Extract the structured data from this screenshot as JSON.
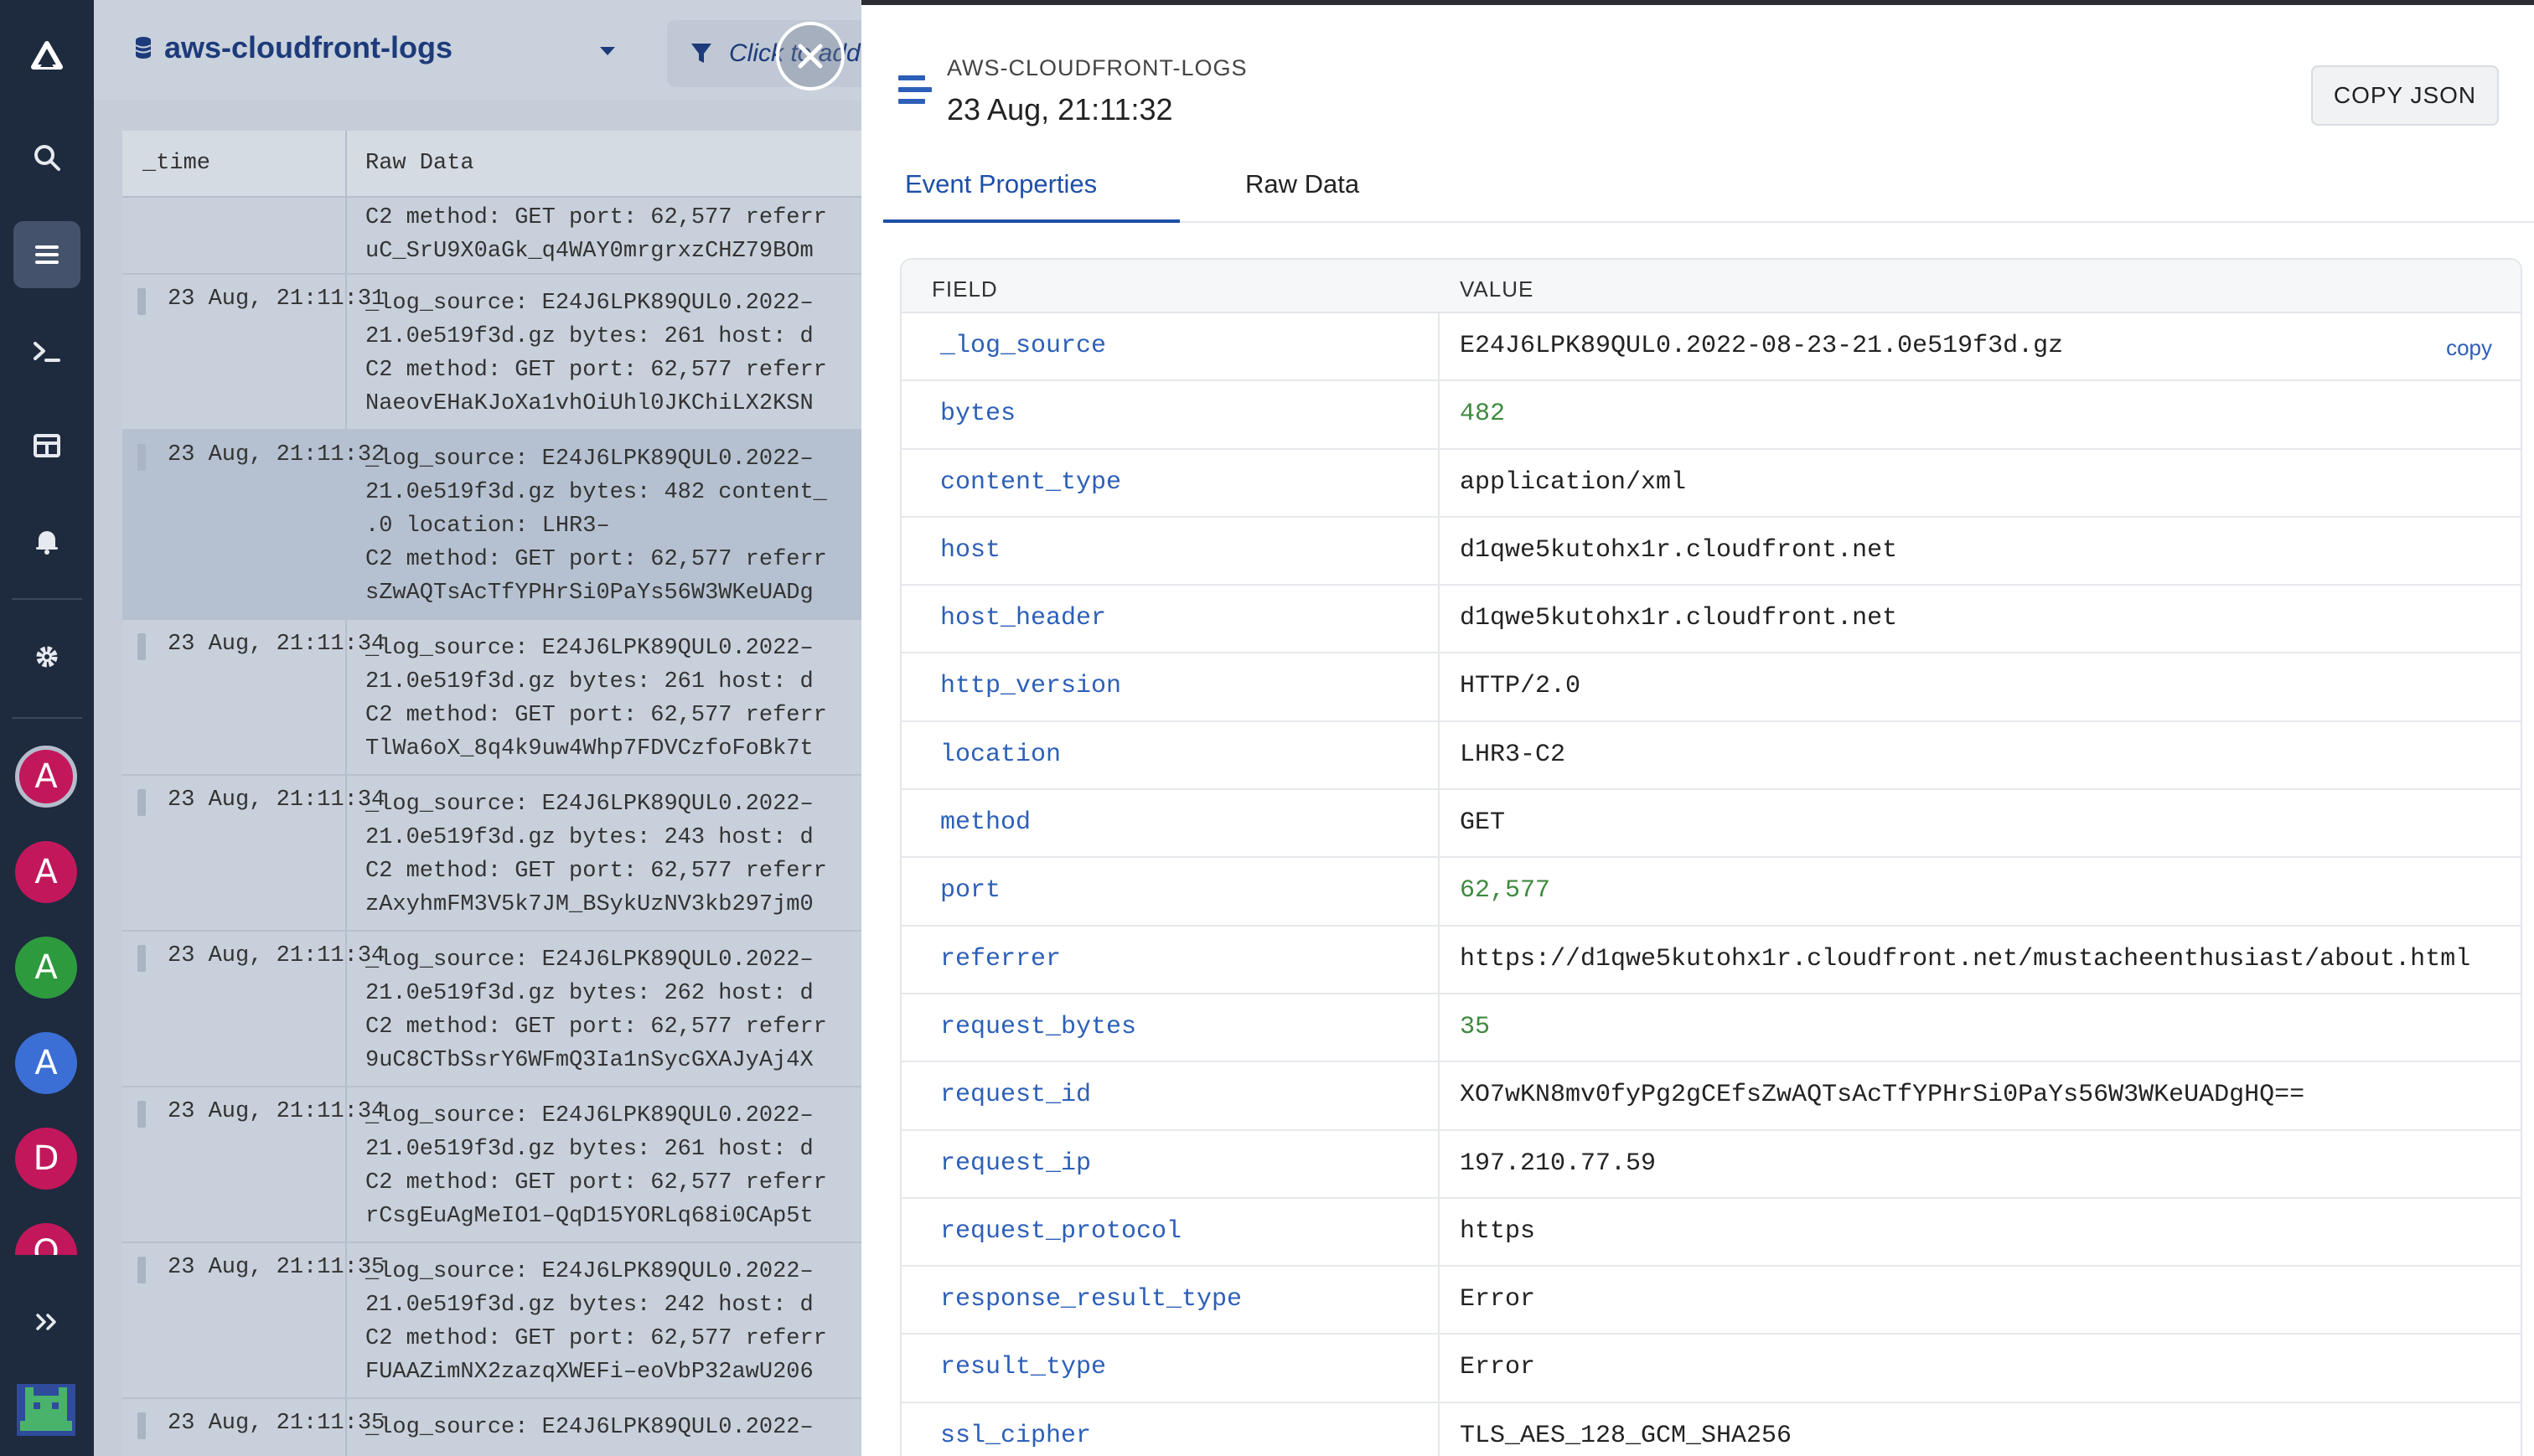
{
  "datasource": {
    "name": "aws-cloudfront-logs",
    "filter_placeholder": "Click to add"
  },
  "table": {
    "col_time": "_time",
    "col_raw": "Raw Data",
    "rows": [
      {
        "time": "",
        "lines": [
          "C2 method: GET port: 62,577 referr",
          "uC_SrU9X0aGk_q4WAY0mrgrxzCHZ79BOm"
        ]
      },
      {
        "time": "23 Aug, 21:11:31",
        "lines": [
          "_log_source: E24J6LPK89QUL0.2022–",
          "21.0e519f3d.gz bytes: 261 host: d",
          "C2 method: GET port: 62,577 referr",
          "NaeovEHaKJoXa1vhOiUhl0JKChiLX2KSN"
        ]
      },
      {
        "time": "23 Aug, 21:11:32",
        "lines": [
          "_log_source: E24J6LPK89QUL0.2022–",
          "21.0e519f3d.gz bytes: 482 content_",
          ".0 location: LHR3–",
          "C2 method: GET port: 62,577 referr",
          "sZwAQTsAcTfYPHrSi0PaYs56W3WKeUADg"
        ]
      },
      {
        "time": "23 Aug, 21:11:34",
        "lines": [
          "_log_source: E24J6LPK89QUL0.2022–",
          "21.0e519f3d.gz bytes: 261 host: d",
          "C2 method: GET port: 62,577 referr",
          "TlWa6oX_8q4k9uw4Whp7FDVCzfoFoBk7t"
        ]
      },
      {
        "time": "23 Aug, 21:11:34",
        "lines": [
          "_log_source: E24J6LPK89QUL0.2022–",
          "21.0e519f3d.gz bytes: 243 host: d",
          "C2 method: GET port: 62,577 referr",
          "zAxyhmFM3V5k7JM_BSykUzNV3kb297jm0"
        ]
      },
      {
        "time": "23 Aug, 21:11:34",
        "lines": [
          "_log_source: E24J6LPK89QUL0.2022–",
          "21.0e519f3d.gz bytes: 262 host: d",
          "C2 method: GET port: 62,577 referr",
          "9uC8CTbSsrY6WFmQ3Ia1nSycGXAJyAj4X"
        ]
      },
      {
        "time": "23 Aug, 21:11:34",
        "lines": [
          "_log_source: E24J6LPK89QUL0.2022–",
          "21.0e519f3d.gz bytes: 261 host: d",
          "C2 method: GET port: 62,577 referr",
          "rCsgEuAgMeIO1–QqD15YORLq68i0CAp5t"
        ]
      },
      {
        "time": "23 Aug, 21:11:35",
        "lines": [
          "_log_source: E24J6LPK89QUL0.2022–",
          "21.0e519f3d.gz bytes: 242 host: d",
          "C2 method: GET port: 62,577 referr",
          "FUAAZimNX2zazqXWEFi–eoVbP32awU206"
        ]
      },
      {
        "time": "23 Aug, 21:11:35",
        "lines": [
          "_log_source: E24J6LPK89QUL0.2022–"
        ]
      }
    ]
  },
  "avatars": [
    {
      "letter": "A",
      "color": "#c2185b"
    },
    {
      "letter": "A",
      "color": "#c2185b"
    },
    {
      "letter": "A",
      "color": "#2e9a3e"
    },
    {
      "letter": "A",
      "color": "#3b6fd6"
    },
    {
      "letter": "D",
      "color": "#c2185b"
    },
    {
      "letter": "O",
      "color": "#c2185b"
    }
  ],
  "panel": {
    "source": "AWS-CLOUDFRONT-LOGS",
    "title": "23 Aug, 21:11:32",
    "copy_json": "COPY JSON",
    "tabs": [
      "Event Properties",
      "Raw Data"
    ],
    "head_field": "FIELD",
    "head_value": "VALUE",
    "copy_label": "copy",
    "properties": [
      {
        "field": "_log_source",
        "value": "E24J6LPK89QUL0.2022-08-23-21.0e519f3d.gz",
        "numeric": false
      },
      {
        "field": "bytes",
        "value": "482",
        "numeric": true
      },
      {
        "field": "content_type",
        "value": "application/xml",
        "numeric": false
      },
      {
        "field": "host",
        "value": "d1qwe5kutohx1r.cloudfront.net",
        "numeric": false
      },
      {
        "field": "host_header",
        "value": "d1qwe5kutohx1r.cloudfront.net",
        "numeric": false
      },
      {
        "field": "http_version",
        "value": "HTTP/2.0",
        "numeric": false
      },
      {
        "field": "location",
        "value": "LHR3-C2",
        "numeric": false
      },
      {
        "field": "method",
        "value": "GET",
        "numeric": false
      },
      {
        "field": "port",
        "value": "62,577",
        "numeric": true
      },
      {
        "field": "referrer",
        "value": "https://d1qwe5kutohx1r.cloudfront.net/mustacheenthusiast/about.html",
        "numeric": false
      },
      {
        "field": "request_bytes",
        "value": "35",
        "numeric": true
      },
      {
        "field": "request_id",
        "value": "XO7wKN8mv0fyPg2gCEfsZwAQTsAcTfYPHrSi0PaYs56W3WKeUADgHQ==",
        "numeric": false
      },
      {
        "field": "request_ip",
        "value": "197.210.77.59",
        "numeric": false
      },
      {
        "field": "request_protocol",
        "value": "https",
        "numeric": false
      },
      {
        "field": "response_result_type",
        "value": "Error",
        "numeric": false
      },
      {
        "field": "result_type",
        "value": "Error",
        "numeric": false
      },
      {
        "field": "ssl_cipher",
        "value": "TLS_AES_128_GCM_SHA256",
        "numeric": false
      }
    ]
  }
}
